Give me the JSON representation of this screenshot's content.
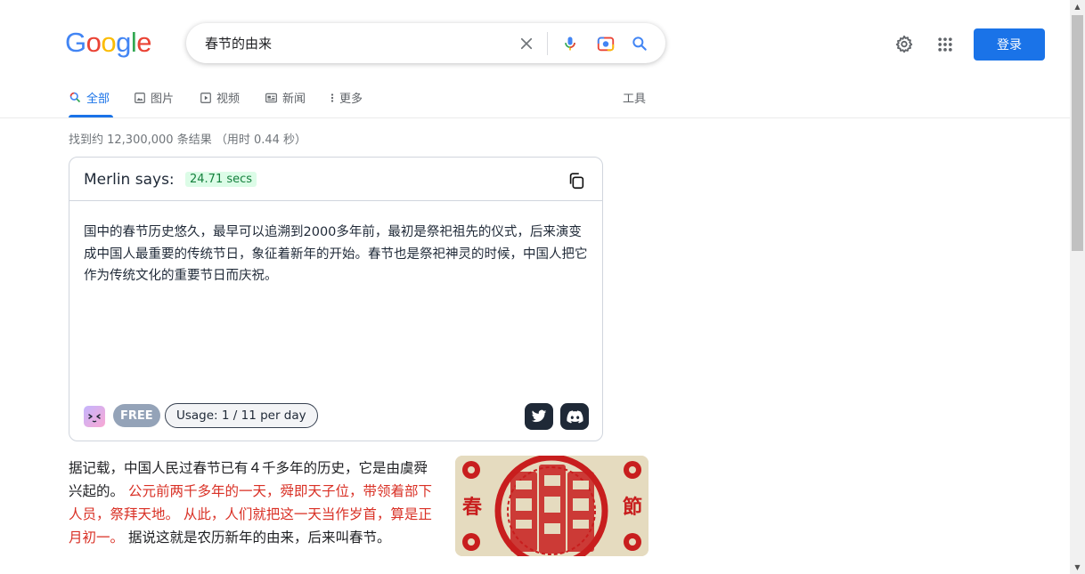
{
  "search": {
    "query": "春节的由来"
  },
  "logo": {
    "letters": [
      "G",
      "o",
      "o",
      "g",
      "l",
      "e"
    ],
    "colors": [
      "#4285F4",
      "#EA4335",
      "#FBBC05",
      "#4285F4",
      "#34A853",
      "#EA4335"
    ]
  },
  "header": {
    "login_label": "登录"
  },
  "tabs": [
    {
      "label": "全部",
      "icon": "search-icon",
      "active": true
    },
    {
      "label": "图片",
      "icon": "image-icon"
    },
    {
      "label": "视频",
      "icon": "video-icon"
    },
    {
      "label": "新闻",
      "icon": "news-icon"
    },
    {
      "label": "更多",
      "icon": "more-vert-icon"
    }
  ],
  "tools_label": "工具",
  "stats": "找到约 12,300,000 条结果  （用时 0.44 秒）",
  "merlin": {
    "title": "Merlin says:",
    "time": "24.71 secs",
    "body": "国中的春节历史悠久，最早可以追溯到2000多年前，最初是祭祀祖先的仪式，后来演变成中国人最重要的传统节日，象征着新年的开始。春节也是祭祀神灵的时候，中国人把它作为传统文化的重要节日而庆祝。",
    "free_label": "FREE",
    "usage_label": "Usage: 1 / 11 per day"
  },
  "snippet": {
    "part1": "据记载，中国人民过春节已有４千多年的历史，它是由虞舜兴起的。",
    "highlight": "公元前两千多年的一天，舜即天子位，带领着部下人员，祭拜天地。 从此，人们就把这一天当作岁首，算是正月初一。",
    "part2": "据说这就是农历新年的由来，后来叫春节。"
  },
  "thumbnail": {
    "left_char": "春",
    "right_char": "節"
  },
  "colors": {
    "accent": "#1a73e8",
    "highlight_red": "#d93025",
    "merlin_green": "#15803d"
  }
}
